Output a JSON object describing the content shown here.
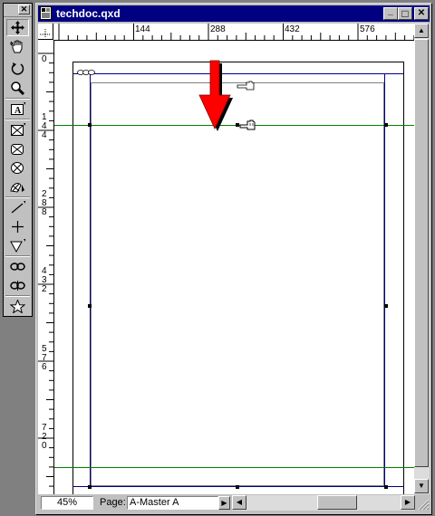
{
  "palette": {
    "close_glyph": "✕",
    "tools": [
      {
        "name": "item-tool-icon"
      },
      {
        "name": "content-tool-icon"
      },
      {
        "name": "rotation-tool-icon"
      },
      {
        "name": "zoom-tool-icon"
      },
      {
        "name": "text-box-tool-icon"
      },
      {
        "name": "rectangle-picture-box-tool-icon"
      },
      {
        "name": "rounded-picture-box-tool-icon"
      },
      {
        "name": "oval-picture-box-tool-icon"
      },
      {
        "name": "bezier-picture-box-tool-icon"
      },
      {
        "name": "line-tool-icon"
      },
      {
        "name": "orthogonal-line-tool-icon"
      },
      {
        "name": "bezier-line-tool-icon"
      },
      {
        "name": "linking-tool-icon"
      },
      {
        "name": "unlinking-tool-icon"
      },
      {
        "name": "star-tool-icon"
      }
    ]
  },
  "window": {
    "title": "techdoc.qxd",
    "minimize_glyph": "_",
    "maximize_glyph": "□",
    "close_glyph": "✕"
  },
  "hruler": {
    "labels": [
      "144",
      "288",
      "432",
      "576"
    ]
  },
  "vruler": {
    "labels": [
      {
        "chars": [
          "0"
        ]
      },
      {
        "chars": [
          "1",
          "4",
          "4"
        ]
      },
      {
        "chars": [
          "2",
          "8",
          "8"
        ]
      },
      {
        "chars": [
          "4",
          "3",
          "2"
        ]
      },
      {
        "chars": [
          "5",
          "7",
          "6"
        ]
      },
      {
        "chars": [
          "7",
          "2",
          "0"
        ]
      }
    ]
  },
  "status": {
    "zoom": "45%",
    "page_label": "Page:",
    "page_value": "A-Master A"
  },
  "colors": {
    "title_bar": "#000080",
    "margin_guide": "#000080",
    "ruler_guide": "#008000",
    "arrow": "#ff0000"
  }
}
